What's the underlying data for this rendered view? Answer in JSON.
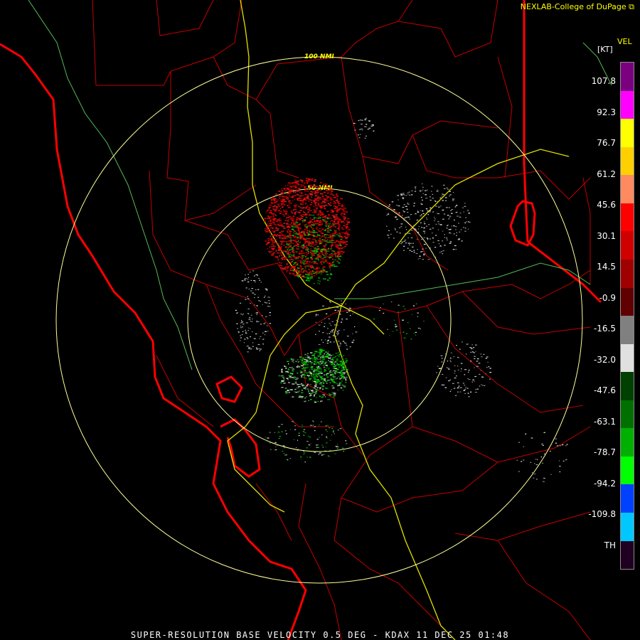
{
  "credit": "NEXLAB-College of DuPage",
  "legend": {
    "product": "VEL",
    "units": "[KT]",
    "ticks": [
      "107.8",
      "92.3",
      "76.7",
      "61.2",
      "45.6",
      "30.1",
      "14.5",
      "-0.9",
      "-16.5",
      "-32.0",
      "-47.6",
      "-63.1",
      "-78.7",
      "-94.2",
      "-109.8",
      "TH"
    ],
    "colors": [
      "#7a0080",
      "#ff00ff",
      "#ffff00",
      "#ffd000",
      "#ff8a60",
      "#ff0000",
      "#d00000",
      "#a00000",
      "#600000",
      "#808080",
      "#e0e0e0",
      "#004000",
      "#007000",
      "#00b000",
      "#00ff00",
      "#0040ff",
      "#00c8ff",
      "#200020"
    ]
  },
  "range_rings": [
    "100 NMI",
    "50 NMI"
  ],
  "footer": "SUPER-RESOLUTION BASE VELOCITY 0.5 DEG - KDAX 11 DEC 25 01:48",
  "colors": {
    "state_border": "#ff0000",
    "county_border": "#cc0000",
    "highway": "#ffff00",
    "river": "#66cc66",
    "range_ring": "#ffff99"
  }
}
